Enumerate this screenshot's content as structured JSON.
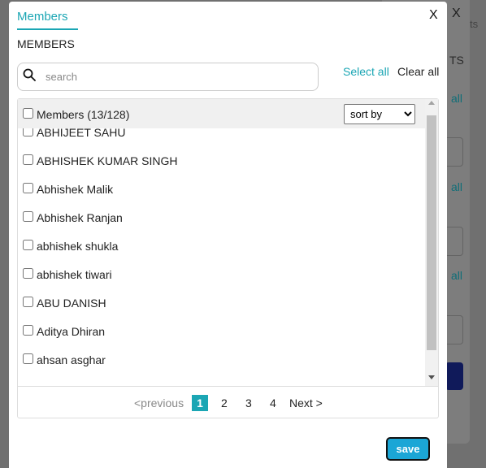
{
  "modal": {
    "tab_label": "Members",
    "close_label": "X",
    "section_title": "MEMBERS"
  },
  "search": {
    "placeholder": "search",
    "value": ""
  },
  "actions": {
    "select_all": "Select all",
    "clear_all": "Clear all"
  },
  "list": {
    "header_label": "Members (13/128)",
    "sort_selected": "sort by",
    "items": [
      "ABHIJEET SAHU",
      "ABHISHEK KUMAR SINGH",
      "Abhishek Malik",
      "Abhishek Ranjan",
      "abhishek shukla",
      "abhishek tiwari",
      "ABU DANISH",
      "Aditya Dhiran",
      "ahsan asghar"
    ]
  },
  "pagination": {
    "previous": "<previous",
    "current": "1",
    "pages": [
      "2",
      "3",
      "4"
    ],
    "next": "Next >"
  },
  "footer": {
    "save": "save"
  },
  "background": {
    "close_label": "X",
    "fragments": [
      "ts",
      "TS",
      "all",
      "all",
      "all"
    ]
  },
  "colors": {
    "accent": "#1ba6b4",
    "save_button": "#1ba6d6"
  }
}
